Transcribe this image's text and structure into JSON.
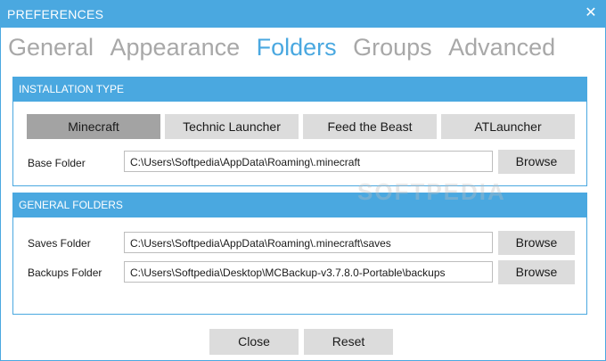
{
  "window": {
    "title": "PREFERENCES",
    "close_glyph": "✕"
  },
  "tabs": [
    {
      "label": "General"
    },
    {
      "label": "Appearance"
    },
    {
      "label": "Folders"
    },
    {
      "label": "Groups"
    },
    {
      "label": "Advanced"
    }
  ],
  "active_tab": "Folders",
  "installation": {
    "header": "INSTALLATION TYPE",
    "types": [
      {
        "label": "Minecraft",
        "selected": true
      },
      {
        "label": "Technic Launcher",
        "selected": false
      },
      {
        "label": "Feed the Beast",
        "selected": false
      },
      {
        "label": "ATLauncher",
        "selected": false
      }
    ],
    "base_label": "Base Folder",
    "base_value": "C:\\Users\\Softpedia\\AppData\\Roaming\\.minecraft",
    "browse_label": "Browse"
  },
  "general": {
    "header": "GENERAL FOLDERS",
    "saves_label": "Saves Folder",
    "saves_value": "C:\\Users\\Softpedia\\AppData\\Roaming\\.minecraft\\saves",
    "backups_label": "Backups Folder",
    "backups_value": "C:\\Users\\Softpedia\\Desktop\\MCBackup-v3.7.8.0-Portable\\backups",
    "browse_label": "Browse"
  },
  "footer": {
    "close_label": "Close",
    "reset_label": "Reset"
  },
  "watermark": "SOFTPEDIA",
  "colors": {
    "accent": "#4aa8e0",
    "button": "#dcdcdc",
    "selected_button": "#a3a3a3",
    "inactive_tab": "#a8a8a8"
  }
}
